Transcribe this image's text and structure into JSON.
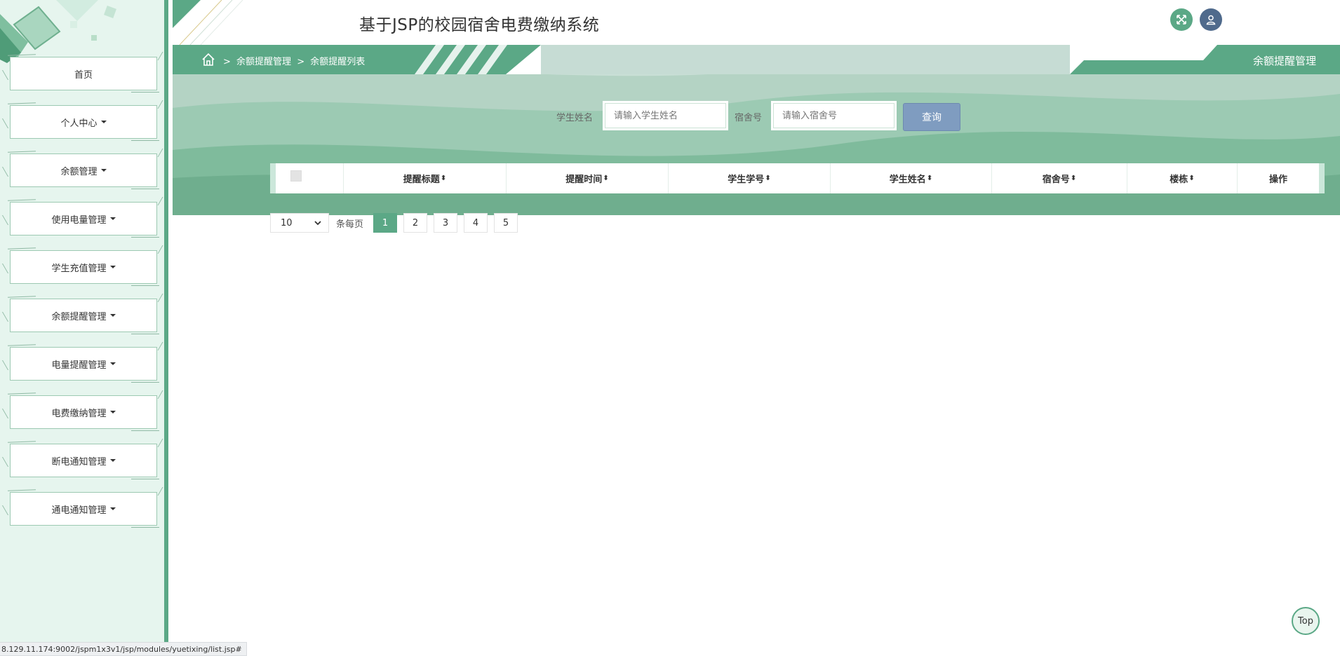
{
  "header": {
    "title": "基于JSP的校园宿舍电费缴纳系统"
  },
  "sidebar": {
    "items": [
      {
        "label": "首页",
        "has_caret": false
      },
      {
        "label": "个人中心",
        "has_caret": true
      },
      {
        "label": "余额管理",
        "has_caret": true
      },
      {
        "label": "使用电量管理",
        "has_caret": true
      },
      {
        "label": "学生充值管理",
        "has_caret": true
      },
      {
        "label": "余额提醒管理",
        "has_caret": true
      },
      {
        "label": "电量提醒管理",
        "has_caret": true
      },
      {
        "label": "电费缴纳管理",
        "has_caret": true
      },
      {
        "label": "断电通知管理",
        "has_caret": true
      },
      {
        "label": "通电通知管理",
        "has_caret": true
      }
    ]
  },
  "breadcrumb": {
    "sep1": ">",
    "level1": "余额提醒管理",
    "sep2": ">",
    "level2": "余额提醒列表"
  },
  "page_tab": {
    "label": "余额提醒管理"
  },
  "search": {
    "student_name_label": "学生姓名",
    "student_name_placeholder": "请输入学生姓名",
    "dorm_label": "宿舍号",
    "dorm_placeholder": "请输入宿舍号",
    "query_button": "查询"
  },
  "table": {
    "columns": [
      "提醒标题",
      "提醒时间",
      "学生学号",
      "学生姓名",
      "宿舍号",
      "楼栋",
      "操作"
    ],
    "sortable": [
      true,
      true,
      true,
      true,
      true,
      true,
      false
    ],
    "rows": []
  },
  "pagination": {
    "page_size": "10",
    "per_page_label": "条每页",
    "pages": [
      "1",
      "2",
      "3",
      "4",
      "5"
    ],
    "current": "1"
  },
  "top_button": "Top",
  "status_url": "8.129.11.174:9002/jspm1x3v1/jsp/modules/yuetixing/list.jsp#",
  "colors": {
    "primary": "#5ba886",
    "sidebar_bg": "#e6f5ee",
    "query_button": "#7f9cc0",
    "user_icon_bg": "#4f6a8c"
  }
}
